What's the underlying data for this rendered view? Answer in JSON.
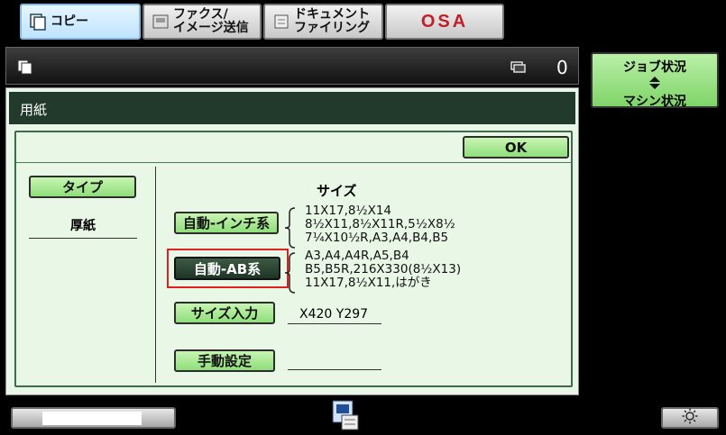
{
  "tabs": [
    {
      "label": "コピー"
    },
    {
      "label": "ファクス/\nイメージ送信"
    },
    {
      "label": "ドキュメント\nファイリング"
    },
    {
      "label": "OSA"
    }
  ],
  "header": {
    "counter": "0"
  },
  "panel": {
    "title": "用紙",
    "ok_label": "OK",
    "type_label": "タイプ",
    "type_value": "厚紙",
    "size_heading": "サイズ",
    "inch_button": "自動-インチ系",
    "inch_sizes": "11X17,8½X14\n8½X11,8½X11R,5½X8½\n7¼X10½R,A3,A4,B4,B5",
    "ab_button": "自動-AB系",
    "ab_sizes": "A3,A4,A4R,A5,B4\nB5,B5R,216X330(8½X13)\n11X17,8½X11,はがき",
    "size_input_button": "サイズ入力",
    "size_input_value": "X420 Y297",
    "manual_button": "手動設定",
    "manual_value": ""
  },
  "job_status": {
    "line1": "ジョブ状況",
    "line2": "マシン状況"
  },
  "colors": {
    "accent_green": "#8fde7a",
    "selection_red": "#e02020",
    "title_bar": "#223a2c"
  }
}
